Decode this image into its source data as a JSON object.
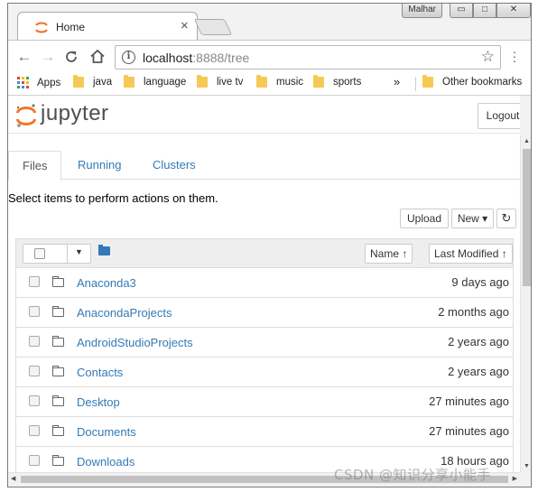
{
  "browser": {
    "tab_title": "Home",
    "tab_close": "×",
    "user_badge": "Malhar",
    "window_controls": {
      "minimize": "▭",
      "maximize": "□",
      "close": "✕"
    },
    "url_host": "localhost",
    "url_path": ":8888/tree",
    "nav": {
      "back": "←",
      "forward": "→",
      "reload": "C",
      "home": "⌂",
      "star": "☆",
      "info": "i"
    },
    "bookmarks": {
      "apps": "Apps",
      "items": [
        "java",
        "language",
        "live tv",
        "music",
        "sports"
      ],
      "overflow": "»",
      "other": "Other bookmarks"
    }
  },
  "jupyter": {
    "wordmark": "jupyter",
    "logout": "Logout",
    "tabs": [
      "Files",
      "Running",
      "Clusters"
    ],
    "active_tab": "Files",
    "hint": "Select items to perform actions on them.",
    "upload": "Upload",
    "new": "New ▾",
    "refresh": "↻",
    "sort_name": "Name ↑",
    "sort_modified": "Last Modified ↑",
    "rows": [
      {
        "name": "Anaconda3",
        "modified": "9 days ago"
      },
      {
        "name": "AnacondaProjects",
        "modified": "2 months ago"
      },
      {
        "name": "AndroidStudioProjects",
        "modified": "2 years ago"
      },
      {
        "name": "Contacts",
        "modified": "2 years ago"
      },
      {
        "name": "Desktop",
        "modified": "27 minutes ago"
      },
      {
        "name": "Documents",
        "modified": "27 minutes ago"
      },
      {
        "name": "Downloads",
        "modified": "18 hours ago"
      }
    ]
  },
  "watermark": "CSDN @知识分享小能手",
  "colors": {
    "link": "#337ab7",
    "jupyter_orange": "#f37726",
    "folder_yellow": "#f7c853"
  }
}
